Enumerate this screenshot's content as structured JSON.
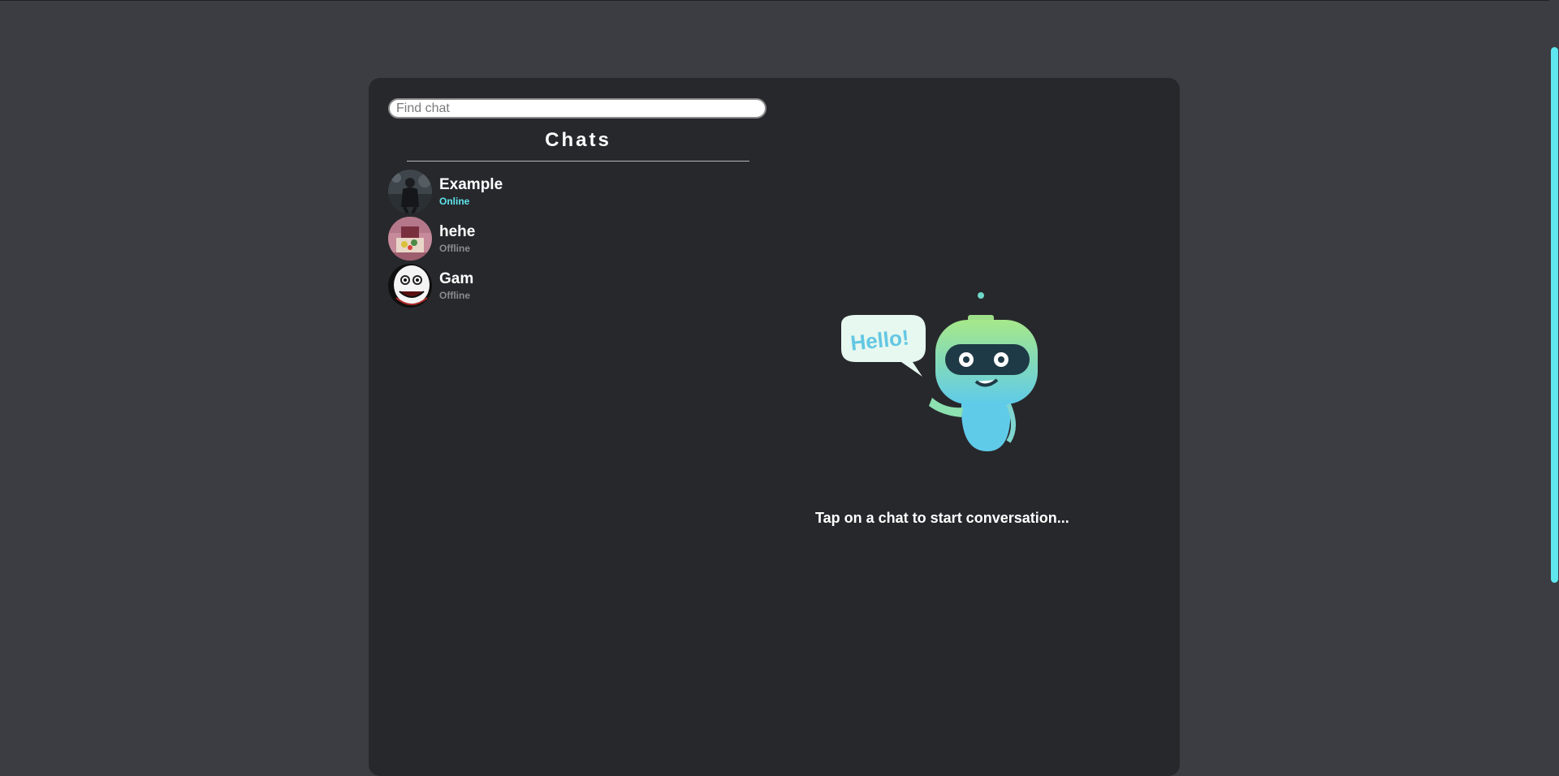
{
  "search": {
    "placeholder": "Find chat"
  },
  "sidebar": {
    "title": "Chats",
    "chats": [
      {
        "name": "Example",
        "status": "Online"
      },
      {
        "name": "hehe",
        "status": "Offline"
      },
      {
        "name": "Gam",
        "status": "Offline"
      }
    ]
  },
  "welcome": {
    "bubble_text": "Hello!",
    "message": "Tap on a chat to start conversation..."
  },
  "colors": {
    "accent": "#5fe6ee",
    "background": "#3c3d42",
    "panel": "#27282c",
    "offline": "#8a8b90"
  }
}
